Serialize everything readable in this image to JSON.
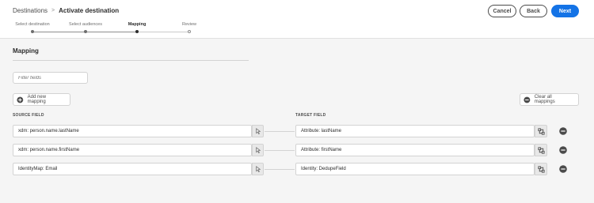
{
  "breadcrumb": {
    "root": "Destinations",
    "separator": ">",
    "current": "Activate destination"
  },
  "actions": {
    "cancel": "Cancel",
    "back": "Back",
    "next": "Next"
  },
  "colors": {
    "accent": "#1473e6",
    "text": "#2c2c2c",
    "border": "#d3d3d3"
  },
  "steps": [
    {
      "label": "Select destination",
      "state": "done"
    },
    {
      "label": "Select audiences",
      "state": "done"
    },
    {
      "label": "Mapping",
      "state": "current"
    },
    {
      "label": "Review",
      "state": "pending"
    }
  ],
  "section": {
    "title": "Mapping"
  },
  "filter": {
    "placeholder": "Filter fields"
  },
  "buttons": {
    "add_mapping": "Add new mapping",
    "clear_all": "Clear all mappings"
  },
  "columns": {
    "source": "SOURCE FIELD",
    "target": "TARGET FIELD"
  },
  "mappings": [
    {
      "source": "xdm: person.name.lastName",
      "target": "Attribute: lastName"
    },
    {
      "source": "xdm: person.name.firstName",
      "target": "Attribute: firstName"
    },
    {
      "source": "IdentityMap: Email",
      "target": "Identity: DedupeField"
    }
  ],
  "icons": {
    "source_picker": "cursor-select-icon",
    "target_picker": "schema-map-icon",
    "remove": "remove-circle-icon",
    "add": "add-circle-icon",
    "clear": "remove-circle-icon"
  }
}
